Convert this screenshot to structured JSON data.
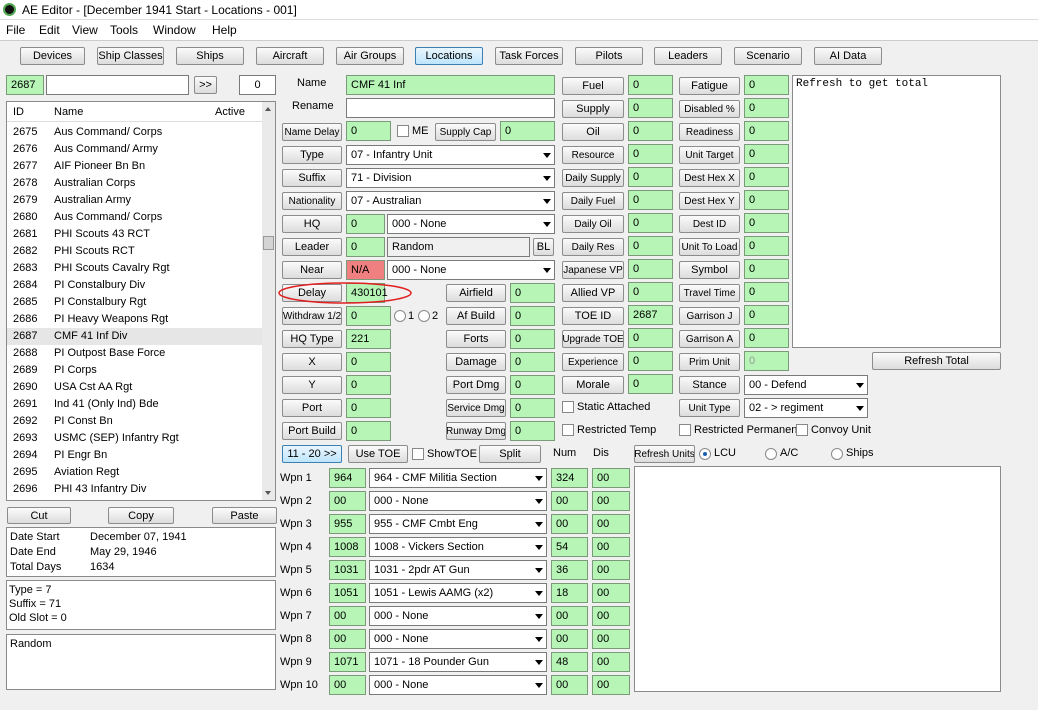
{
  "window": {
    "title": "AE Editor - [December 1941 Start - Locations - 001]"
  },
  "menu": [
    "File",
    "Edit",
    "View",
    "Tools",
    "Window",
    "Help"
  ],
  "tabs": [
    "Devices",
    "Ship Classes",
    "Ships",
    "Aircraft",
    "Air Groups",
    "Locations",
    "Task Forces",
    "Pilots",
    "Leaders",
    "Scenario",
    "AI Data"
  ],
  "active_tab": "Locations",
  "search": {
    "id_value": "2687",
    "text_value": "",
    "go_label": ">>",
    "count_value": "0"
  },
  "list": {
    "headers": [
      "ID",
      "Name",
      "Active"
    ],
    "rows": [
      {
        "id": "2675",
        "name": "Aus Command/ Corps"
      },
      {
        "id": "2676",
        "name": "Aus Command/ Army"
      },
      {
        "id": "2677",
        "name": "AIF Pioneer Bn Bn"
      },
      {
        "id": "2678",
        "name": "Australian Corps"
      },
      {
        "id": "2679",
        "name": "Australian Army"
      },
      {
        "id": "2680",
        "name": "Aus Command/ Corps"
      },
      {
        "id": "2681",
        "name": "PHI Scouts 43 RCT"
      },
      {
        "id": "2682",
        "name": "PHI Scouts RCT"
      },
      {
        "id": "2683",
        "name": "PHI Scouts Cavalry Rgt"
      },
      {
        "id": "2684",
        "name": "PI Constalbury Div"
      },
      {
        "id": "2685",
        "name": "PI Constalbury Rgt"
      },
      {
        "id": "2686",
        "name": "PI Heavy Weapons Rgt"
      },
      {
        "id": "2687",
        "name": "CMF 41 Inf Div"
      },
      {
        "id": "2688",
        "name": "PI Outpost Base Force"
      },
      {
        "id": "2689",
        "name": "PI Corps"
      },
      {
        "id": "2690",
        "name": "USA Cst AA Rgt"
      },
      {
        "id": "2691",
        "name": "Ind 41 (Only Ind) Bde"
      },
      {
        "id": "2692",
        "name": "PI Const Bn"
      },
      {
        "id": "2693",
        "name": "USMC (SEP) Infantry Rgt"
      },
      {
        "id": "2694",
        "name": "PI Engr Bn"
      },
      {
        "id": "2695",
        "name": "Aviation Regt"
      },
      {
        "id": "2696",
        "name": "PHI 43 Infantry Div"
      }
    ],
    "selected_index": 12
  },
  "clipboard": {
    "cut": "Cut",
    "copy": "Copy",
    "paste": "Paste"
  },
  "dates": {
    "start_label": "Date Start",
    "start_value": "December 07, 1941",
    "end_label": "Date End",
    "end_value": "May 29, 1946",
    "total_label": "Total Days",
    "total_value": "1634"
  },
  "info": {
    "line1": "Type = 7",
    "line2": "Suffix = 71",
    "line3": "Old Slot = 0"
  },
  "random_box": "Random",
  "form": {
    "name_label": "Name",
    "name_value": "CMF 41 Inf",
    "rename_label": "Rename",
    "rename_value": "",
    "name_delay_label": "Name Delay",
    "name_delay_value": "0",
    "me_label": "ME",
    "supply_cap_label": "Supply Cap",
    "supply_cap_value": "0",
    "type_label": "Type",
    "type_value": "07 - Infantry Unit",
    "suffix_label": "Suffix",
    "suffix_value": "71 - Division",
    "nationality_label": "Nationality",
    "nationality_value": "07 - Australian",
    "hq_label": "HQ",
    "hq_value": "0",
    "hq_combo": "000 - None",
    "leader_label": "Leader",
    "leader_value": "0",
    "leader_name": "Random",
    "bl_label": "BL",
    "near_label": "Near",
    "near_value": "N/A",
    "near_combo": "000 - None",
    "delay_label": "Delay",
    "delay_value": "430101",
    "withdraw_label": "Withdraw 1/2",
    "withdraw_value": "0",
    "radio1": "1",
    "radio2": "2",
    "hq_type_label": "HQ Type",
    "hq_type_value": "221",
    "x_label": "X",
    "x_value": "0",
    "y_label": "Y",
    "y_value": "0",
    "port_label": "Port",
    "port_value": "0",
    "port_build_label": "Port Build",
    "port_build_value": "0",
    "airfield_label": "Airfield",
    "airfield_value": "0",
    "af_build_label": "Af Build",
    "af_build_value": "0",
    "forts_label": "Forts",
    "forts_value": "0",
    "damage_label": "Damage",
    "damage_value": "0",
    "port_dmg_label": "Port Dmg",
    "port_dmg_value": "0",
    "service_dmg_label": "Service Dmg",
    "service_dmg_value": "0",
    "runway_dmg_label": "Runway Dmg",
    "runway_dmg_value": "0",
    "fuel_label": "Fuel",
    "fuel_value": "0",
    "supply_label": "Supply",
    "supply_value": "0",
    "oil_label": "Oil",
    "oil_value": "0",
    "resource_label": "Resource",
    "resource_value": "0",
    "daily_supply_label": "Daily Supply",
    "daily_supply_value": "0",
    "daily_fuel_label": "Daily Fuel",
    "daily_fuel_value": "0",
    "daily_oil_label": "Daily Oil",
    "daily_oil_value": "0",
    "daily_res_label": "Daily Res",
    "daily_res_value": "0",
    "japanese_vp_label": "Japanese VP",
    "japanese_vp_value": "0",
    "allied_vp_label": "Allied VP",
    "allied_vp_value": "0",
    "toe_id_label": "TOE ID",
    "toe_id_value": "2687",
    "upgrade_toe_label": "Upgrade TOE",
    "upgrade_toe_value": "0",
    "experience_label": "Experience",
    "experience_value": "0",
    "morale_label": "Morale",
    "morale_value": "0",
    "static_attached_label": "Static Attached",
    "restricted_temp_label": "Restricted Temp",
    "fatigue_label": "Fatigue",
    "fatigue_value": "0",
    "disabled_label": "Disabled %",
    "disabled_value": "0",
    "readiness_label": "Readiness",
    "readiness_value": "0",
    "unit_target_label": "Unit Target",
    "unit_target_value": "0",
    "dest_hex_x_label": "Dest Hex X",
    "dest_hex_x_value": "0",
    "dest_hex_y_label": "Dest Hex Y",
    "dest_hex_y_value": "0",
    "dest_id_label": "Dest ID",
    "dest_id_value": "0",
    "unit_to_load_label": "Unit To Load",
    "unit_to_load_value": "0",
    "symbol_label": "Symbol",
    "symbol_value": "0",
    "travel_time_label": "Travel Time",
    "travel_time_value": "0",
    "garrison_j_label": "Garrison J",
    "garrison_j_value": "0",
    "garrison_a_label": "Garrison A",
    "garrison_a_value": "0",
    "prim_unit_label": "Prim Unit",
    "prim_unit_value": "0",
    "stance_label": "Stance",
    "stance_value": "00 - Defend",
    "unit_type_label": "Unit Type",
    "unit_type_value": "02 - > regiment",
    "restricted_perm_label": "Restricted Permanent",
    "convoy_label": "Convoy Unit",
    "notes_text": "Refresh to get total",
    "refresh_total_label": "Refresh Total"
  },
  "weapons_bar": {
    "page_label": "11 - 20 >>",
    "use_toe_label": "Use TOE",
    "show_toe_label": "ShowTOE",
    "split_label": "Split",
    "num_header": "Num",
    "dis_header": "Dis",
    "refresh_units_label": "Refresh Units",
    "lcu_label": "LCU",
    "ac_label": "A/C",
    "ships_label": "Ships"
  },
  "weapons": [
    {
      "label": "Wpn 1",
      "id": "964",
      "name": "964 - CMF Militia Section",
      "num": "324",
      "dis": "00"
    },
    {
      "label": "Wpn 2",
      "id": "00",
      "name": "000 - None",
      "num": "00",
      "dis": "00"
    },
    {
      "label": "Wpn 3",
      "id": "955",
      "name": "955 - CMF Cmbt Eng",
      "num": "00",
      "dis": "00"
    },
    {
      "label": "Wpn 4",
      "id": "1008",
      "name": "1008 - Vickers Section",
      "num": "54",
      "dis": "00"
    },
    {
      "label": "Wpn 5",
      "id": "1031",
      "name": "1031 - 2pdr AT Gun",
      "num": "36",
      "dis": "00"
    },
    {
      "label": "Wpn 6",
      "id": "1051",
      "name": "1051 - Lewis AAMG (x2)",
      "num": "18",
      "dis": "00"
    },
    {
      "label": "Wpn 7",
      "id": "00",
      "name": "000 - None",
      "num": "00",
      "dis": "00"
    },
    {
      "label": "Wpn 8",
      "id": "00",
      "name": "000 - None",
      "num": "00",
      "dis": "00"
    },
    {
      "label": "Wpn 9",
      "id": "1071",
      "name": "1071 - 18 Pounder Gun",
      "num": "48",
      "dis": "00"
    },
    {
      "label": "Wpn 10",
      "id": "00",
      "name": "000 - None",
      "num": "00",
      "dis": "00"
    }
  ],
  "colors": {
    "field_green": "#b6f5b6",
    "field_red": "#f08080",
    "highlight_ellipse": "#e02020",
    "selected_tab": "#bee6fd"
  }
}
